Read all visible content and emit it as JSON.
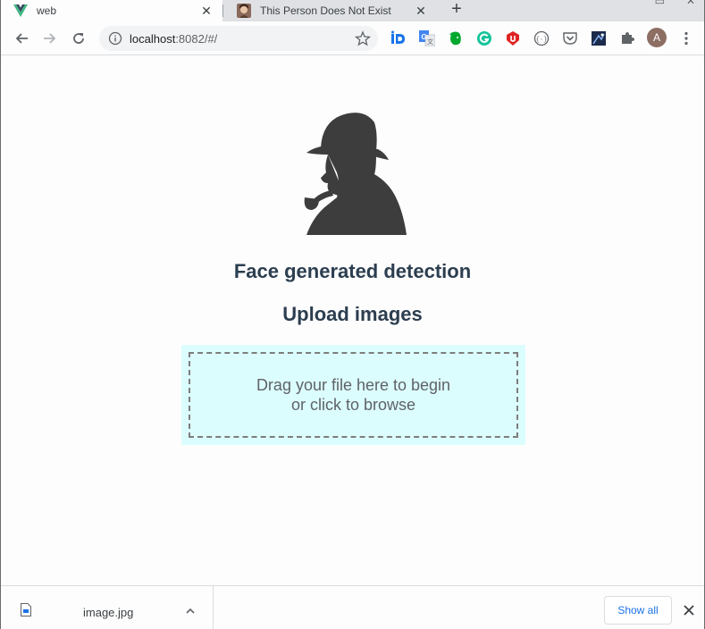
{
  "browser": {
    "tabs": [
      {
        "title": "web",
        "active": true,
        "favicon": "vue-logo-icon"
      },
      {
        "title": "This Person Does Not Exist",
        "active": false,
        "favicon": "person-photo-icon"
      }
    ],
    "url_host": "localhost",
    "url_rest": ":8082/#/",
    "extensions": [
      "id-extension-icon",
      "google-translate-icon",
      "evernote-icon",
      "grammarly-icon",
      "ublock-icon",
      "code-extension-icon",
      "pocket-icon",
      "image-extension-icon",
      "puzzle-icon"
    ],
    "avatar_letter": "A"
  },
  "page": {
    "title": "Face generated detection",
    "subtitle": "Upload images",
    "dropzone": {
      "line1": "Drag your file here to begin",
      "line2": "or click to browse"
    }
  },
  "downloads": {
    "file_name": "image.jpg",
    "show_all_label": "Show all"
  },
  "colors": {
    "heading": "#2c3e50",
    "dropzone_bg": "#dcfdfd",
    "accent": "#1a73e8",
    "logo": "#3d3d3d"
  }
}
